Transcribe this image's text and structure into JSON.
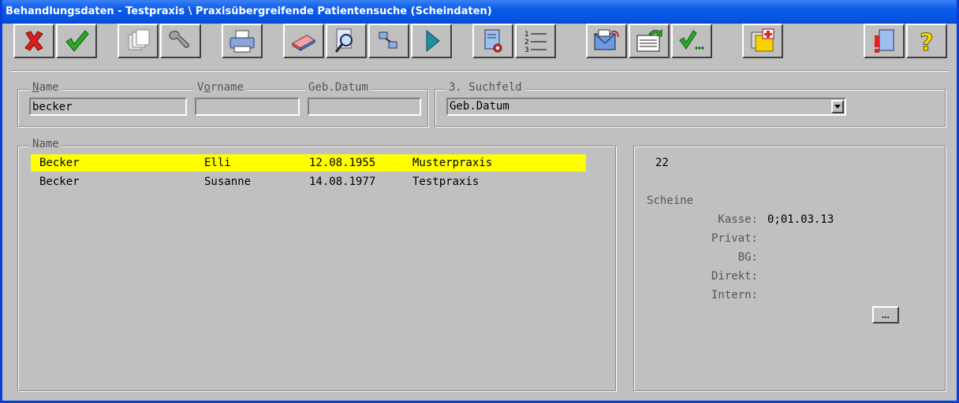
{
  "window": {
    "title": "Behandlungsdaten - Testpraxis \\ Praxisübergreifende Patientensuche (Scheindaten)"
  },
  "toolbar": {
    "buttons": [
      {
        "name": "cancel",
        "icon": "red-x-icon"
      },
      {
        "name": "ok",
        "icon": "green-check-icon"
      },
      {
        "name": "copy",
        "icon": "documents-icon"
      },
      {
        "name": "tools",
        "icon": "wrench-icon"
      },
      {
        "name": "print",
        "icon": "printer-icon"
      },
      {
        "name": "erase",
        "icon": "eraser-icon"
      },
      {
        "name": "search",
        "icon": "magnifier-document-icon"
      },
      {
        "name": "network",
        "icon": "network-icon"
      },
      {
        "name": "play",
        "icon": "play-icon"
      },
      {
        "name": "document-settings",
        "icon": "document-gear-icon"
      },
      {
        "name": "numbered-list",
        "icon": "numbered-list-icon"
      },
      {
        "name": "bdt-import",
        "icon": "bdt-envelope-icon"
      },
      {
        "name": "export",
        "icon": "export-document-icon"
      },
      {
        "name": "check-more",
        "icon": "check-more-icon"
      },
      {
        "name": "patient-folder",
        "icon": "medical-folder-icon"
      },
      {
        "name": "warning-document",
        "icon": "document-warning-icon"
      },
      {
        "name": "help",
        "icon": "question-mark-icon"
      }
    ]
  },
  "search": {
    "name_label_pre": "",
    "name_label_u": "N",
    "name_label_post": "ame",
    "name_value": "becker",
    "vorname_label_pre": "V",
    "vorname_label_u": "o",
    "vorname_label_post": "rname",
    "vorname_value": "",
    "geb_label": "Geb.Datum",
    "geb_value": "",
    "suchfeld_label": "3. Suchfeld",
    "suchfeld_value": "Geb.Datum"
  },
  "results": {
    "group_label": "Name",
    "rows": [
      {
        "name": "Becker",
        "vorname": "Elli",
        "geb": "12.08.1955",
        "praxis": "Musterpraxis",
        "selected": true
      },
      {
        "name": "Becker",
        "vorname": "Susanne",
        "geb": "14.08.1977",
        "praxis": "Testpraxis",
        "selected": false
      }
    ]
  },
  "details": {
    "number": "22",
    "scheine_label": "Scheine",
    "kasse_label": "Kasse:",
    "kasse_value": "0;01.03.13",
    "privat_label": "Privat:",
    "privat_value": "",
    "bg_label": "BG:",
    "bg_value": "",
    "direkt_label": "Direkt:",
    "direkt_value": "",
    "intern_label": "Intern:",
    "intern_value": "",
    "more_label": "..."
  },
  "colors": {
    "title_bar": "#0a59e8",
    "window_bg": "#c0c0c0",
    "selection": "#ffff00"
  }
}
